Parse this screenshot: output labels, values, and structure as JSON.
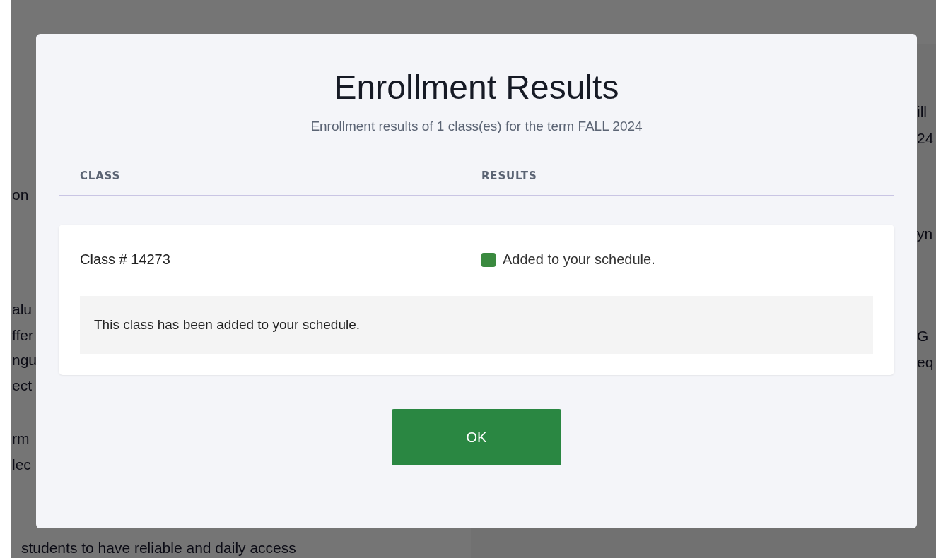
{
  "background": {
    "left_fragments": [
      "on",
      "alu",
      "ffer",
      "ngu",
      "ect",
      "rm",
      "lec"
    ],
    "bottom_text": "students to have reliable and daily access",
    "right_fragments": [
      "ill",
      "24",
      "yn",
      "G",
      "eq"
    ]
  },
  "dialog": {
    "title": "Enrollment Results",
    "subtitle": "Enrollment results of 1 class(es) for the term FALL 2024",
    "columns": [
      "CLASS",
      "RESULTS"
    ],
    "results": [
      {
        "class": "Class # 14273",
        "color": "#3a8a3f",
        "result": "Added to your schedule.",
        "message": "This class has been added to your schedule."
      }
    ],
    "buttons": [
      "OK"
    ]
  }
}
